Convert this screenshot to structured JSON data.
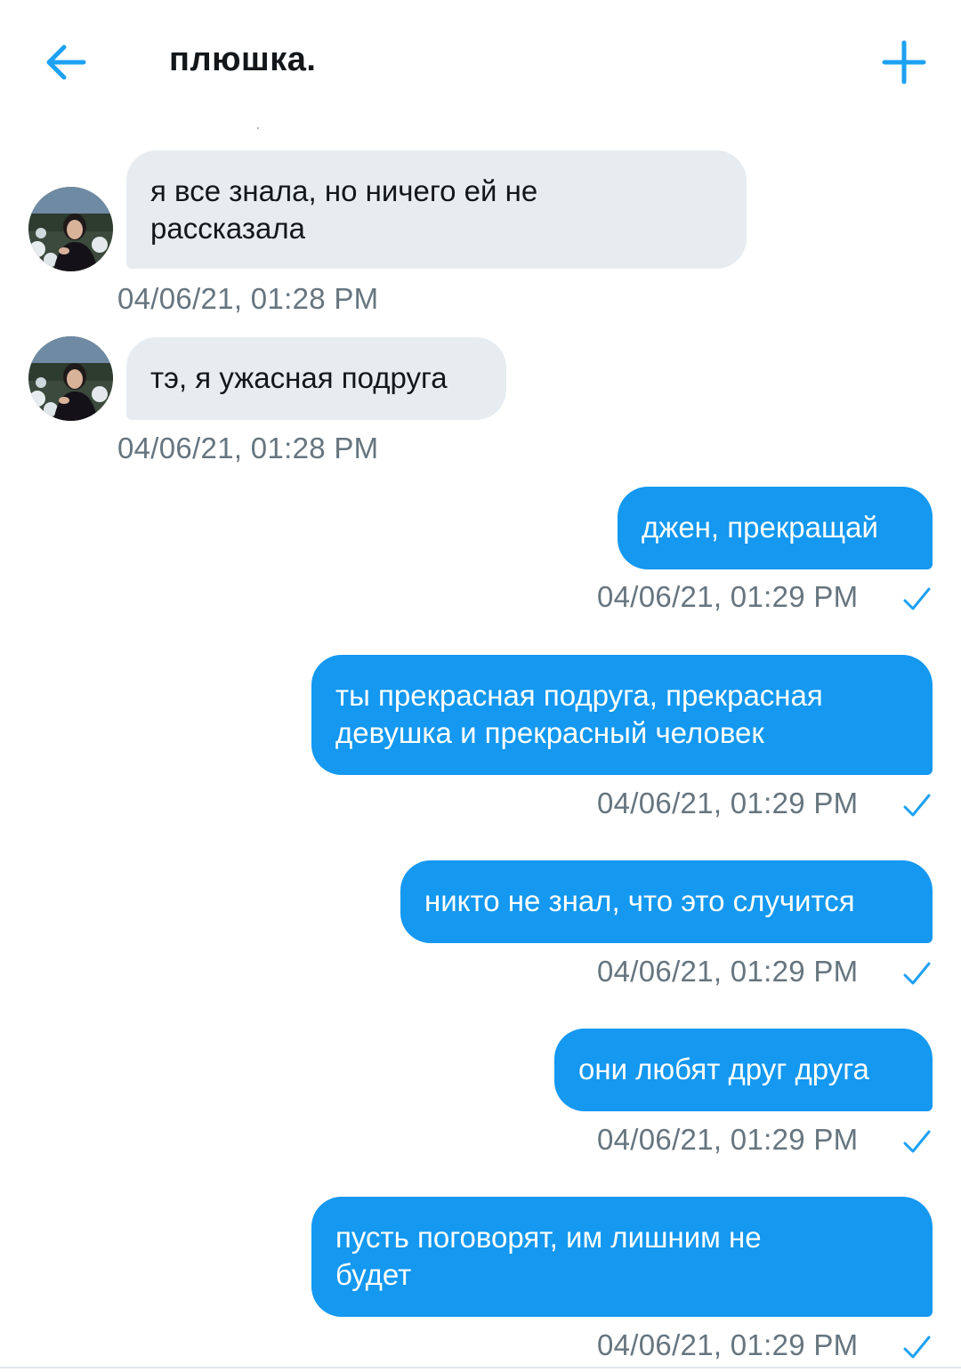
{
  "header": {
    "title": "плюшка.",
    "back_icon": "arrow-left-icon",
    "new_icon": "plus-icon",
    "accent": "#1da1f2"
  },
  "messages": [
    {
      "direction": "in",
      "text": "я все знала, но ничего ей не\nрассказала",
      "timestamp": "04/06/21, 01:28 PM"
    },
    {
      "direction": "in",
      "text": "тэ, я ужасная подруга",
      "timestamp": "04/06/21, 01:28 PM"
    },
    {
      "direction": "out",
      "text": "джен, прекращай",
      "timestamp": "04/06/21, 01:29 PM",
      "status_icon": "checkmark-icon"
    },
    {
      "direction": "out",
      "text": "ты прекрасная подруга, прекрасная\nдевушка и прекрасный человек",
      "timestamp": "04/06/21, 01:29 PM",
      "status_icon": "checkmark-icon"
    },
    {
      "direction": "out",
      "text": "никто не знал, что это случится",
      "timestamp": "04/06/21, 01:29 PM",
      "status_icon": "checkmark-icon"
    },
    {
      "direction": "out",
      "text": "они любят друг друга",
      "timestamp": "04/06/21, 01:29 PM",
      "status_icon": "checkmark-icon"
    },
    {
      "direction": "out",
      "text": "пусть поговорят, им лишним не\nбудет",
      "timestamp": "04/06/21, 01:29 PM",
      "status_icon": "checkmark-icon"
    }
  ],
  "colors": {
    "incoming_bubble": "#e6ecf0",
    "outgoing_bubble": "#1498f0",
    "timestamp": "#66757f",
    "check": "#1da1f2"
  }
}
